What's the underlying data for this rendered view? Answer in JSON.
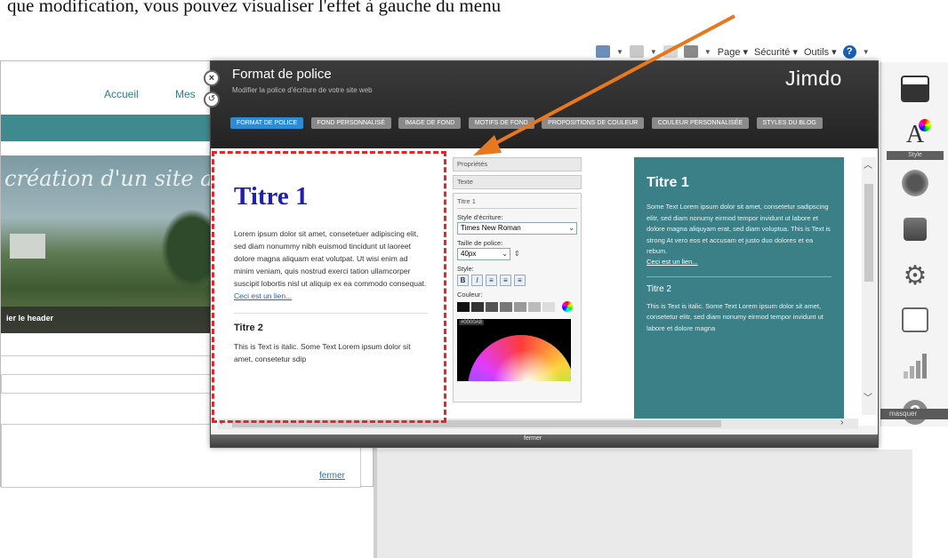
{
  "caption": "que modification, vous pouvez visualiser l'effet à gauche du menu",
  "browser": {
    "page_label": "Page",
    "security_label": "Sécurité",
    "tools_label": "Outils",
    "help_symbol": "?"
  },
  "site": {
    "nav": {
      "home": "Accueil",
      "mes": "Mes"
    },
    "header_title": "création d'un site a",
    "header_caption": "ier le header",
    "close_link": "fermer"
  },
  "dialog": {
    "title": "Format de police",
    "subtitle": "Modifier la police d'écriture de votre site web",
    "brand": "Jimdo",
    "close_symbol": "×",
    "tabs": [
      {
        "label": "Format de police",
        "active": true
      },
      {
        "label": "Fond personnalisé",
        "active": false
      },
      {
        "label": "Image de fond",
        "active": false
      },
      {
        "label": "Motifs de fond",
        "active": false
      },
      {
        "label": "Propositions de couleur",
        "active": false
      },
      {
        "label": "Couleur personnalisée",
        "active": false
      },
      {
        "label": "Styles du blog",
        "active": false
      }
    ],
    "footer_label": "fermer"
  },
  "preview_left": {
    "h1": "Titre 1",
    "p1": "Lorem ipsum dolor sit amet, consetetuer adipiscing elit, sed diam nonummy nibh euismod tincidunt ut laoreet dolore magna aliquam erat volutpat. Ut wisi enim ad minim veniam, quis nostrud exerci tation ullamcorper suscipit lobortis nisl ut aliquip ex ea commodo consequat.",
    "link": "Ceci est un lien...",
    "h2": "Titre 2",
    "p2": "This is Text is italic. Some Text Lorem ipsum dolor sit amet, consetetur sdip"
  },
  "properties": {
    "header1": "Propriétés",
    "header2": "Texte",
    "header3": "Titre 1",
    "font_label": "Style d'écriture:",
    "font_value": "Times New Roman",
    "size_label": "Taille de police:",
    "size_value": "40px",
    "style_label": "Style:",
    "style_buttons": [
      "B",
      "I",
      "≡",
      "≡",
      "≡"
    ],
    "color_label": "Couleur:",
    "swatches": [
      "#111111",
      "#333333",
      "#555555",
      "#777777",
      "#999999",
      "#bbbbbb",
      "#dddddd"
    ],
    "picker_hex": "#0000A8"
  },
  "preview_right": {
    "h1": "Titre 1",
    "p1": "Some Text Lorem ipsum dolor sit amet, consetetur sadipscing elitr, sed diam nonumy eirmod tempor invidunt ut labore et dolore magna aliquyam erat, sed diam voluptua. This is Text is strong At vero eos et accusam et justo duo dolores et ea rebum.",
    "link": "Ceci est un lien...",
    "h2": "Titre 2",
    "p2": "This is Text is italic. Some Text Lorem ipsum dolor sit amet, consetetur elitr, sed diam nonumy eirmod tempor invidunt ut labore et dolore magna"
  },
  "toolbar": {
    "design_label": "Style",
    "hide_label": "masquer"
  },
  "colors": {
    "accent": "#2d8bd6",
    "teal": "#3b8087",
    "arrow": "#e8781e",
    "dash": "#e8242a"
  }
}
